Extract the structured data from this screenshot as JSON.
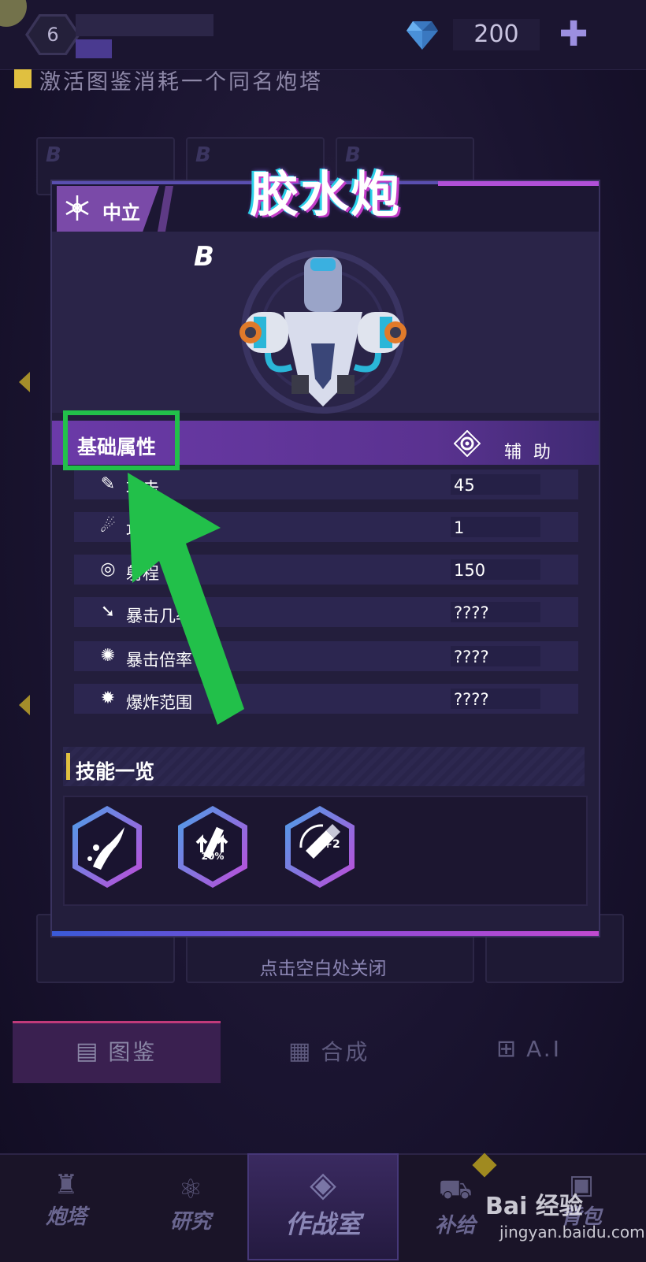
{
  "top_bar": {
    "level": "6",
    "gems": "200",
    "add_icon": "plus-icon",
    "gem_icon": "diamond-icon",
    "hint": "激活图鉴消耗一个同名炮塔"
  },
  "background_cards": {
    "grade": "B"
  },
  "modal": {
    "faction": "中立",
    "faction_icon": "snowflake-icon",
    "tower_name": "胶水炮",
    "rarity": "B",
    "attributes": {
      "title": "基础属性",
      "role_label": "辅 助",
      "role_icon": "gear-icon",
      "rows": [
        {
          "label": "攻击",
          "value": "45",
          "icon": "pencil-icon"
        },
        {
          "label": "攻速",
          "value": "1",
          "icon": "comet-icon"
        },
        {
          "label": "射程",
          "value": "150",
          "icon": "target-icon"
        },
        {
          "label": "暴击几率",
          "value": "????",
          "icon": "crit-arrow-icon"
        },
        {
          "label": "暴击倍率",
          "value": "????",
          "icon": "crit-burst-icon"
        },
        {
          "label": "爆炸范围",
          "value": "????",
          "icon": "explosion-icon"
        }
      ]
    },
    "skills": {
      "title": "技能一览",
      "items": [
        {
          "icon": "glue-splash-icon",
          "badge": ""
        },
        {
          "icon": "speed-up-icon",
          "badge": "20%"
        },
        {
          "icon": "glue-bottle-icon",
          "badge": "+2"
        }
      ]
    },
    "close_hint": "点击空白处关闭"
  },
  "tabs": [
    {
      "label": "图鉴",
      "icon": "book-icon",
      "active": true
    },
    {
      "label": "合成",
      "icon": "grid-icon",
      "active": false
    },
    {
      "label": "A.I",
      "icon": "chip-icon",
      "active": false
    }
  ],
  "bottom_nav": [
    {
      "label": "炮塔",
      "icon": "turret-icon"
    },
    {
      "label": "研究",
      "icon": "atom-icon"
    },
    {
      "label": "作战室",
      "icon": "diamond-frame-icon"
    },
    {
      "label": "补给",
      "icon": "cart-icon"
    },
    {
      "label": "背包",
      "icon": "bag-icon"
    }
  ],
  "watermark": {
    "brand": "Bai 经验",
    "url": "jingyan.baidu.com"
  },
  "colors": {
    "highlight": "#22c04a",
    "accent_purple": "#7a4aa8",
    "glitch_pink": "#c23cc8",
    "glitch_cyan": "#2ad0e8"
  }
}
